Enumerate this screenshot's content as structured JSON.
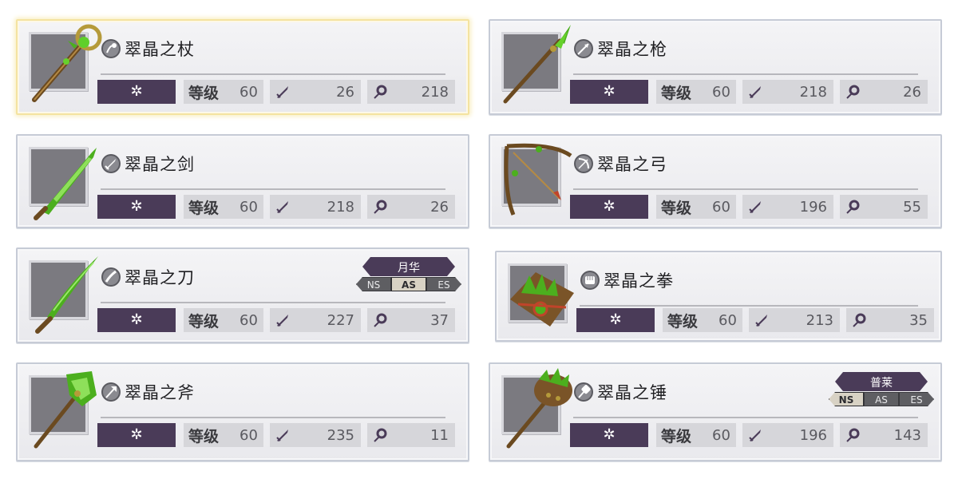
{
  "colors": {
    "element_bg": "#4a3b58",
    "chip_bg": "#d6d6da",
    "weapon_green": "#4caf1e",
    "weapon_bronze": "#8a6a3a",
    "selected_border": "#f4e3a0"
  },
  "cards": [
    {
      "name": "翠晶之杖",
      "type_icon": "staff-type-icon",
      "element": "✲",
      "level_label": "等级",
      "level": "60",
      "atk": "26",
      "mag": "218",
      "selected": true
    },
    {
      "name": "翠晶之枪",
      "type_icon": "spear-type-icon",
      "element": "✲",
      "level_label": "等级",
      "level": "60",
      "atk": "218",
      "mag": "26"
    },
    {
      "name": "翠晶之剑",
      "type_icon": "sword-type-icon",
      "element": "✲",
      "level_label": "等级",
      "level": "60",
      "atk": "218",
      "mag": "26"
    },
    {
      "name": "翠晶之弓",
      "type_icon": "bow-type-icon",
      "element": "✲",
      "level_label": "等级",
      "level": "60",
      "atk": "196",
      "mag": "55"
    },
    {
      "name": "翠晶之刀",
      "type_icon": "katana-type-icon",
      "element": "✲",
      "level_label": "等级",
      "level": "60",
      "atk": "227",
      "mag": "37",
      "badge": {
        "label": "月华",
        "tabs": [
          "NS",
          "AS",
          "ES"
        ],
        "active": "AS"
      }
    },
    {
      "name": "翠晶之拳",
      "type_icon": "fist-type-icon",
      "element": "✲",
      "level_label": "等级",
      "level": "60",
      "atk": "213",
      "mag": "35"
    },
    {
      "name": "翠晶之斧",
      "type_icon": "axe-type-icon",
      "element": "✲",
      "level_label": "等级",
      "level": "60",
      "atk": "235",
      "mag": "11"
    },
    {
      "name": "翠晶之锤",
      "type_icon": "hammer-type-icon",
      "element": "✲",
      "level_label": "等级",
      "level": "60",
      "atk": "196",
      "mag": "143",
      "badge": {
        "label": "普莱",
        "tabs": [
          "NS",
          "AS",
          "ES"
        ],
        "active": "NS"
      }
    }
  ]
}
